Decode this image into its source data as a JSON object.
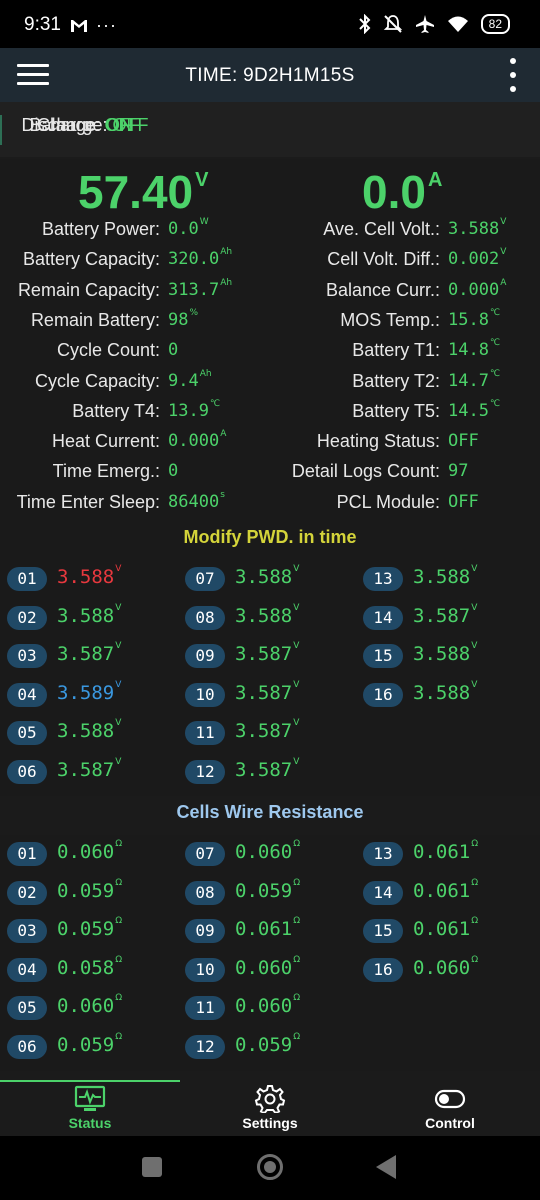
{
  "statusbar": {
    "time": "9:31",
    "dots": "···",
    "battery": "82"
  },
  "appbar": {
    "title": "TIME: 9D2H1M15S"
  },
  "state": {
    "charge_label": "Charge:",
    "charge_value": "ON",
    "discharge_label": "Discharge:",
    "discharge_value": "OFF",
    "balance_label": "Balance:",
    "balance_value": "OFF"
  },
  "main": {
    "voltage": "57.40",
    "voltage_unit": "V",
    "current": "0.0",
    "current_unit": "A",
    "left": [
      {
        "label": "Battery Power:",
        "value": "0.0",
        "unit": "W"
      },
      {
        "label": "Battery Capacity:",
        "value": "320.0",
        "unit": "Ah"
      },
      {
        "label": "Remain Capacity:",
        "value": "313.7",
        "unit": "Ah"
      },
      {
        "label": "Remain Battery:",
        "value": "98",
        "unit": "%"
      },
      {
        "label": "Cycle Count:",
        "value": "0",
        "unit": ""
      },
      {
        "label": "Cycle Capacity:",
        "value": "9.4",
        "unit": "Ah"
      },
      {
        "label": "Battery T4:",
        "value": "13.9",
        "unit": "℃"
      },
      {
        "label": "Heat Current:",
        "value": "0.000",
        "unit": "A"
      },
      {
        "label": "Time Emerg.:",
        "value": "0",
        "unit": ""
      },
      {
        "label": "Time Enter Sleep:",
        "value": "86400",
        "unit": "s"
      }
    ],
    "right": [
      {
        "label": "Ave. Cell Volt.:",
        "value": "3.588",
        "unit": "V"
      },
      {
        "label": "Cell Volt. Diff.:",
        "value": "0.002",
        "unit": "V"
      },
      {
        "label": "Balance Curr.:",
        "value": "0.000",
        "unit": "A"
      },
      {
        "label": "MOS Temp.:",
        "value": "15.8",
        "unit": "℃"
      },
      {
        "label": "Battery T1:",
        "value": "14.8",
        "unit": "℃"
      },
      {
        "label": "Battery T2:",
        "value": "14.7",
        "unit": "℃"
      },
      {
        "label": "Battery T5:",
        "value": "14.5",
        "unit": "℃"
      },
      {
        "label": "Heating Status:",
        "value": "OFF",
        "unit": ""
      },
      {
        "label": "Detail Logs Count:",
        "value": "97",
        "unit": ""
      },
      {
        "label": "PCL Module:",
        "value": "OFF",
        "unit": ""
      }
    ]
  },
  "voltages": {
    "title": "Modify PWD. in time",
    "unit": "V",
    "cells": [
      {
        "id": "01",
        "value": "3.588",
        "color": "#e8383e"
      },
      {
        "id": "02",
        "value": "3.588",
        "color": "#4cd26a"
      },
      {
        "id": "03",
        "value": "3.587",
        "color": "#4cd26a"
      },
      {
        "id": "04",
        "value": "3.589",
        "color": "#3a98e0"
      },
      {
        "id": "05",
        "value": "3.588",
        "color": "#4cd26a"
      },
      {
        "id": "06",
        "value": "3.587",
        "color": "#4cd26a"
      },
      {
        "id": "07",
        "value": "3.588",
        "color": "#4cd26a"
      },
      {
        "id": "08",
        "value": "3.588",
        "color": "#4cd26a"
      },
      {
        "id": "09",
        "value": "3.587",
        "color": "#4cd26a"
      },
      {
        "id": "10",
        "value": "3.587",
        "color": "#4cd26a"
      },
      {
        "id": "11",
        "value": "3.587",
        "color": "#4cd26a"
      },
      {
        "id": "12",
        "value": "3.587",
        "color": "#4cd26a"
      },
      {
        "id": "13",
        "value": "3.588",
        "color": "#4cd26a"
      },
      {
        "id": "14",
        "value": "3.587",
        "color": "#4cd26a"
      },
      {
        "id": "15",
        "value": "3.588",
        "color": "#4cd26a"
      },
      {
        "id": "16",
        "value": "3.588",
        "color": "#4cd26a"
      }
    ]
  },
  "resistance": {
    "title": "Cells Wire Resistance",
    "unit": "Ω",
    "cells": [
      {
        "id": "01",
        "value": "0.060"
      },
      {
        "id": "02",
        "value": "0.059"
      },
      {
        "id": "03",
        "value": "0.059"
      },
      {
        "id": "04",
        "value": "0.058"
      },
      {
        "id": "05",
        "value": "0.060"
      },
      {
        "id": "06",
        "value": "0.059"
      },
      {
        "id": "07",
        "value": "0.060"
      },
      {
        "id": "08",
        "value": "0.059"
      },
      {
        "id": "09",
        "value": "0.061"
      },
      {
        "id": "10",
        "value": "0.060"
      },
      {
        "id": "11",
        "value": "0.060"
      },
      {
        "id": "12",
        "value": "0.059"
      },
      {
        "id": "13",
        "value": "0.061"
      },
      {
        "id": "14",
        "value": "0.061"
      },
      {
        "id": "15",
        "value": "0.061"
      },
      {
        "id": "16",
        "value": "0.060"
      }
    ]
  },
  "bottomnav": {
    "status_label": "Status",
    "settings_label": "Settings",
    "control_label": "Control",
    "active_color": "#4cd26a"
  },
  "colors": {
    "value_green": "#4cd26a",
    "badge": "#204966",
    "appbar": "#1f2a33"
  },
  "icons": {
    "status": "monitor-pulse-icon",
    "settings": "gear-icon",
    "control": "toggle-icon"
  }
}
